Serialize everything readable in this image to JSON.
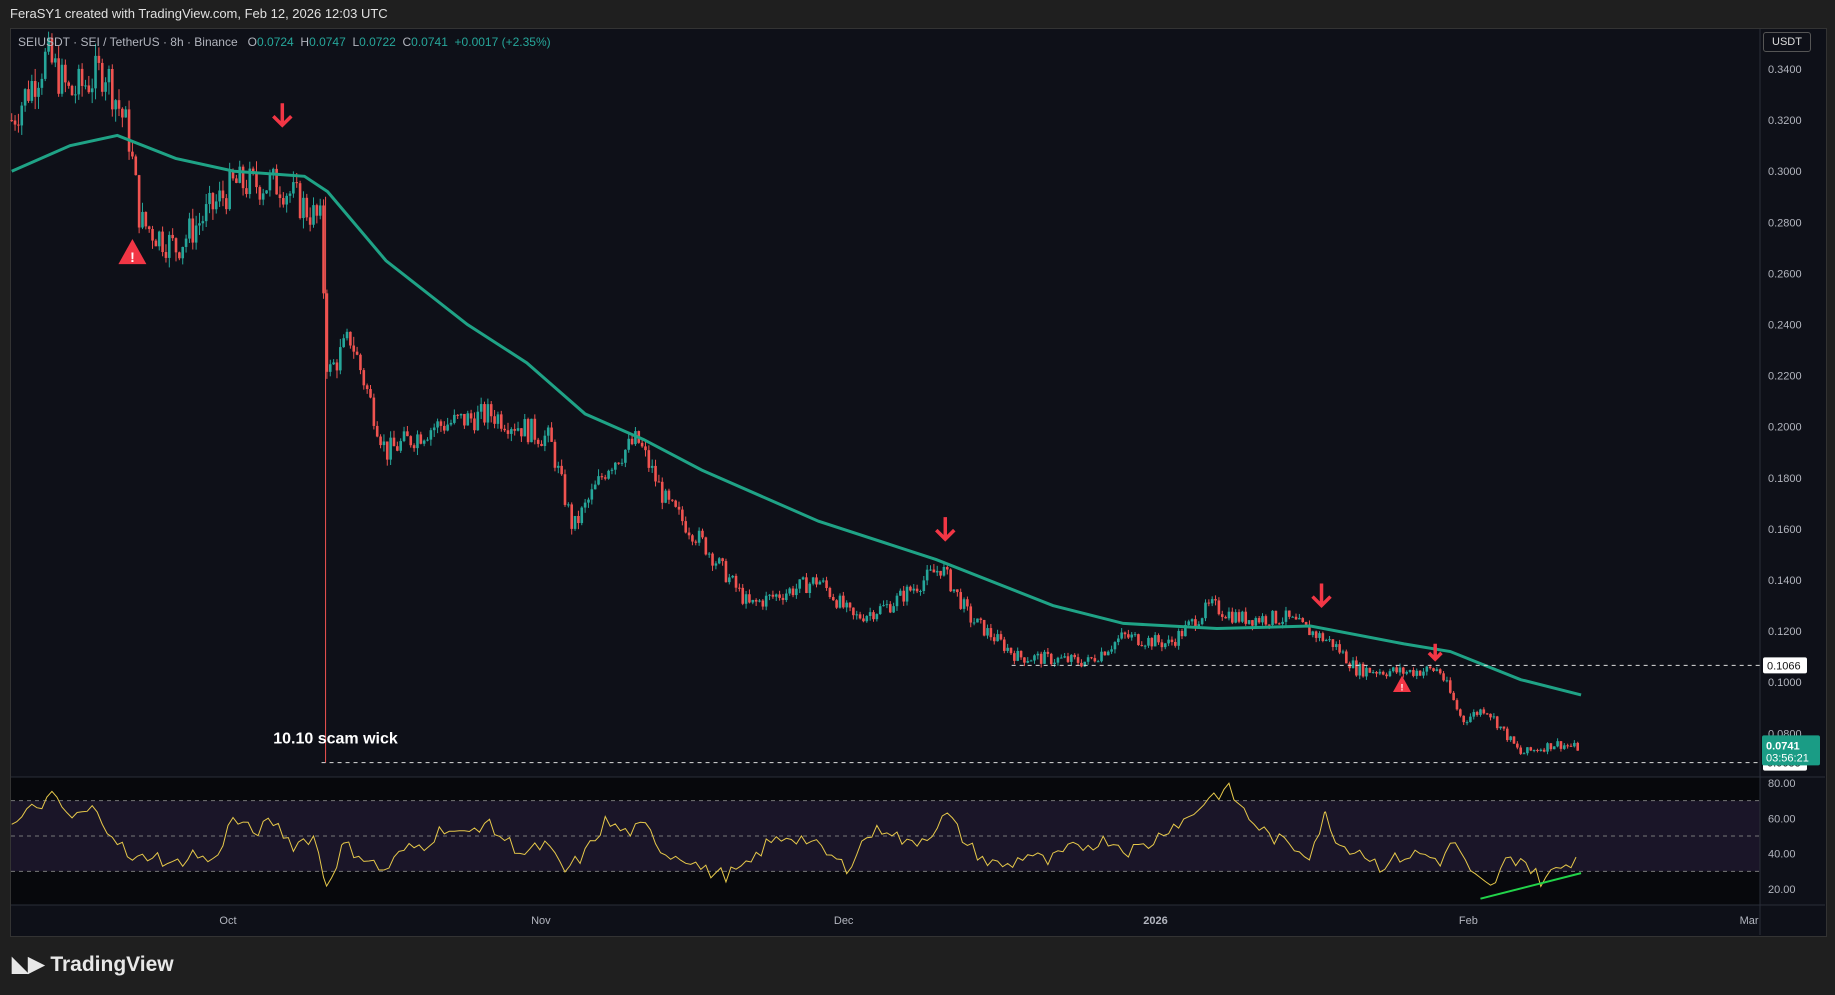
{
  "header": {
    "caption": "FeraSY1 created with TradingView.com, Feb 12, 2026 12:03 UTC"
  },
  "legend": {
    "symbol": "SEIUSDT · SEI / TetherUS · 8h · Binance",
    "o_label": "O",
    "o": "0.0724",
    "h_label": "H",
    "h": "0.0747",
    "l_label": "L",
    "l": "0.0722",
    "c_label": "C",
    "c": "0.0741",
    "change": "+0.0017 (+2.35%)"
  },
  "currency_button": "USDT",
  "logo": "TradingView",
  "colors": {
    "up": "#26a69a",
    "down": "#ef5350",
    "ma": "#1fa386",
    "rsi": "#e6c84a",
    "divergence": "#22d34a",
    "marker": "#f23645"
  },
  "chart_data": [
    {
      "type": "candlestick",
      "title": "SEIUSDT 8h",
      "ylabel": "USDT",
      "ylim": [
        0.066,
        0.356
      ],
      "x_unit": "days since Sep 9 2025",
      "yticks": [
        "0.3400",
        "0.3200",
        "0.3000",
        "0.2800",
        "0.2600",
        "0.2400",
        "0.2200",
        "0.2000",
        "0.1800",
        "0.1600",
        "0.1400",
        "0.1200",
        "0.1000",
        "0.0800"
      ],
      "xticks": [
        {
          "label": "Oct",
          "d": 21.5
        },
        {
          "label": "Nov",
          "d": 52.6
        },
        {
          "label": "Dec",
          "d": 82.7
        },
        {
          "label": "2026",
          "d": 113.7
        },
        {
          "label": "Feb",
          "d": 144.8
        },
        {
          "label": "Mar",
          "d": 172.7
        }
      ],
      "close_path": [
        [
          0,
          0.32
        ],
        [
          3.5,
          0.345
        ],
        [
          5.8,
          0.33
        ],
        [
          9.3,
          0.34
        ],
        [
          11.6,
          0.315
        ],
        [
          12.8,
          0.28
        ],
        [
          16.3,
          0.27
        ],
        [
          22.1,
          0.295
        ],
        [
          26.7,
          0.295
        ],
        [
          30.7,
          0.28
        ],
        [
          31.4,
          0.22
        ],
        [
          33.7,
          0.235
        ],
        [
          37.2,
          0.19
        ],
        [
          41.9,
          0.2
        ],
        [
          47.7,
          0.205
        ],
        [
          53.5,
          0.195
        ],
        [
          55.8,
          0.16
        ],
        [
          59.3,
          0.185
        ],
        [
          62.2,
          0.195
        ],
        [
          65.1,
          0.17
        ],
        [
          68.6,
          0.155
        ],
        [
          73.3,
          0.13
        ],
        [
          80.2,
          0.14
        ],
        [
          83.7,
          0.125
        ],
        [
          87.2,
          0.13
        ],
        [
          92.4,
          0.145
        ],
        [
          95.3,
          0.125
        ],
        [
          100,
          0.11
        ],
        [
          107,
          0.108
        ],
        [
          110.5,
          0.118
        ],
        [
          115.1,
          0.115
        ],
        [
          119.2,
          0.13
        ],
        [
          122.1,
          0.125
        ],
        [
          126.7,
          0.125
        ],
        [
          131.4,
          0.115
        ],
        [
          133.7,
          0.105
        ],
        [
          138.4,
          0.104
        ],
        [
          141.9,
          0.105
        ],
        [
          144.2,
          0.085
        ],
        [
          146.5,
          0.09
        ],
        [
          150,
          0.072
        ],
        [
          153.5,
          0.076
        ],
        [
          156,
          0.0741
        ]
      ],
      "ma_path": [
        [
          0,
          0.3
        ],
        [
          5.8,
          0.31
        ],
        [
          10.5,
          0.314
        ],
        [
          16.3,
          0.305
        ],
        [
          22.1,
          0.3
        ],
        [
          29.1,
          0.298
        ],
        [
          31.4,
          0.292
        ],
        [
          37.2,
          0.265
        ],
        [
          45.3,
          0.24
        ],
        [
          51.2,
          0.225
        ],
        [
          57,
          0.205
        ],
        [
          62.8,
          0.195
        ],
        [
          68.6,
          0.183
        ],
        [
          80.2,
          0.163
        ],
        [
          91.9,
          0.148
        ],
        [
          103.5,
          0.13
        ],
        [
          110.5,
          0.123
        ],
        [
          119.8,
          0.121
        ],
        [
          129.1,
          0.122
        ],
        [
          138.4,
          0.115
        ],
        [
          143,
          0.112
        ],
        [
          150,
          0.101
        ],
        [
          156,
          0.095
        ]
      ],
      "horizontal_lines": [
        {
          "price": 0.1066,
          "label": "0.1066",
          "from_d": 99.4
        },
        {
          "price": 0.0685,
          "label": "0.0688",
          "from_d": 30.8
        }
      ],
      "last_price": {
        "value": "0.0741",
        "countdown": "03:56:21"
      },
      "annotations": [
        {
          "text": "10.10 scam wick",
          "d": 26,
          "price": 0.078
        }
      ],
      "wick": {
        "d": 31.2,
        "high": 0.29,
        "low": 0.0685
      },
      "arrows": [
        {
          "d": 26.9,
          "price": 0.318
        },
        {
          "d": 92.8,
          "price": 0.156
        },
        {
          "d": 130.2,
          "price": 0.13
        },
        {
          "d": 141.5,
          "price": 0.109
        }
      ],
      "warnings": [
        {
          "d": 12,
          "price": 0.268
        },
        {
          "d": 138.2,
          "price": 0.099
        }
      ]
    },
    {
      "type": "line",
      "title": "RSI",
      "ylim": [
        10,
        84
      ],
      "yticks": [
        "80.00",
        "60.00",
        "40.00",
        "20.00"
      ],
      "bands": [
        70,
        50,
        30
      ],
      "values": [
        [
          0,
          55
        ],
        [
          2,
          65
        ],
        [
          4,
          72
        ],
        [
          6,
          60
        ],
        [
          8,
          65
        ],
        [
          10,
          52
        ],
        [
          12,
          35
        ],
        [
          14,
          40
        ],
        [
          16,
          33
        ],
        [
          18,
          40
        ],
        [
          20,
          35
        ],
        [
          22,
          60
        ],
        [
          24,
          52
        ],
        [
          26,
          58
        ],
        [
          28,
          45
        ],
        [
          30,
          50
        ],
        [
          31.3,
          22
        ],
        [
          33,
          45
        ],
        [
          35,
          38
        ],
        [
          37,
          30
        ],
        [
          39,
          42
        ],
        [
          41,
          45
        ],
        [
          43,
          55
        ],
        [
          45,
          50
        ],
        [
          47,
          58
        ],
        [
          49,
          48
        ],
        [
          51,
          40
        ],
        [
          53,
          45
        ],
        [
          55,
          30
        ],
        [
          57,
          40
        ],
        [
          59,
          58
        ],
        [
          61,
          52
        ],
        [
          63,
          55
        ],
        [
          65,
          40
        ],
        [
          67,
          38
        ],
        [
          69,
          30
        ],
        [
          71,
          28
        ],
        [
          73,
          32
        ],
        [
          75,
          45
        ],
        [
          77,
          50
        ],
        [
          79,
          48
        ],
        [
          81,
          40
        ],
        [
          83,
          32
        ],
        [
          85,
          50
        ],
        [
          87,
          55
        ],
        [
          89,
          45
        ],
        [
          91,
          50
        ],
        [
          93,
          62
        ],
        [
          95,
          45
        ],
        [
          97,
          35
        ],
        [
          99,
          33
        ],
        [
          101,
          40
        ],
        [
          103,
          35
        ],
        [
          105,
          42
        ],
        [
          107,
          45
        ],
        [
          109,
          48
        ],
        [
          111,
          42
        ],
        [
          113,
          45
        ],
        [
          115,
          55
        ],
        [
          117,
          60
        ],
        [
          119,
          72
        ],
        [
          121,
          76
        ],
        [
          123,
          60
        ],
        [
          125,
          50
        ],
        [
          127,
          45
        ],
        [
          129,
          40
        ],
        [
          130.6,
          62
        ],
        [
          132,
          45
        ],
        [
          134,
          42
        ],
        [
          136,
          33
        ],
        [
          138,
          38
        ],
        [
          140,
          40
        ],
        [
          142,
          36
        ],
        [
          143.5,
          47
        ],
        [
          145,
          28
        ],
        [
          147,
          20
        ],
        [
          148.5,
          35
        ],
        [
          150,
          38
        ],
        [
          152,
          25
        ],
        [
          154,
          32
        ],
        [
          156,
          40
        ]
      ],
      "divergence": [
        [
          146,
          14.5
        ],
        [
          156,
          29
        ]
      ]
    }
  ]
}
